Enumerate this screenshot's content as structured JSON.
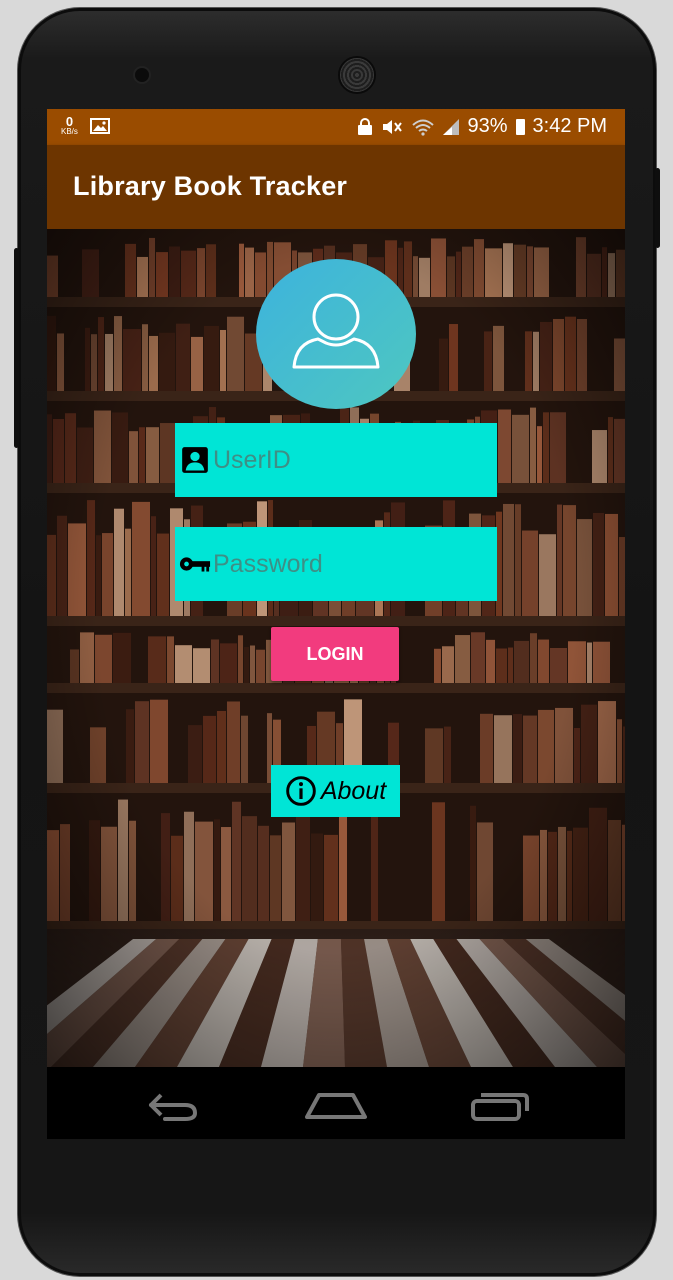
{
  "status_bar": {
    "speed_value": "0",
    "speed_unit": "KB/s",
    "battery": "93%",
    "time": "3:42 PM"
  },
  "app_bar": {
    "title": "Library Book Tracker"
  },
  "login_form": {
    "userid_placeholder": "UserID",
    "password_placeholder": "Password",
    "login_label": "LOGIN",
    "about_label": "About"
  },
  "colors": {
    "status_bar": "#9a4c00",
    "app_bar": "#6d3500",
    "field_bg": "#00e5d6",
    "login_button": "#f23b7e",
    "avatar_gradient": [
      "#3db3dd",
      "#4ec7c0"
    ]
  },
  "icons": {
    "userid": "account-box-icon",
    "password": "key-icon",
    "about": "info-icon",
    "avatar": "person-outline-icon"
  },
  "nav_bar": {
    "back": "back-icon",
    "home": "home-icon",
    "recents": "recents-icon"
  }
}
